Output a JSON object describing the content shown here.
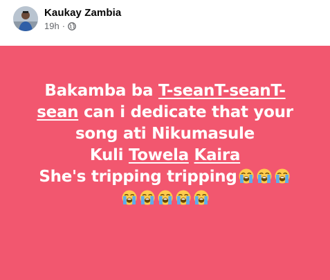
{
  "post": {
    "author": "Kaukay Zambia",
    "time": "19h",
    "separator": "·",
    "privacy_icon": "globe-icon"
  },
  "banner": {
    "background": "#f2576f",
    "line1_pre": "Bakamba ba ",
    "line1_tag": "T-seanT-seanT-",
    "line2_tag": "sean",
    "line2_post": " can i dedicate that your",
    "line3": "song ati Nikumasule",
    "line4_pre": "Kuli ",
    "line4_tag1": "Towela",
    "line4_space": " ",
    "line4_tag2": "Kaira",
    "line5": "She's tripping tripping",
    "emoji_name": "loudly-crying-face-icon",
    "emoji_count_line5": 3,
    "emoji_count_line6": 5
  }
}
